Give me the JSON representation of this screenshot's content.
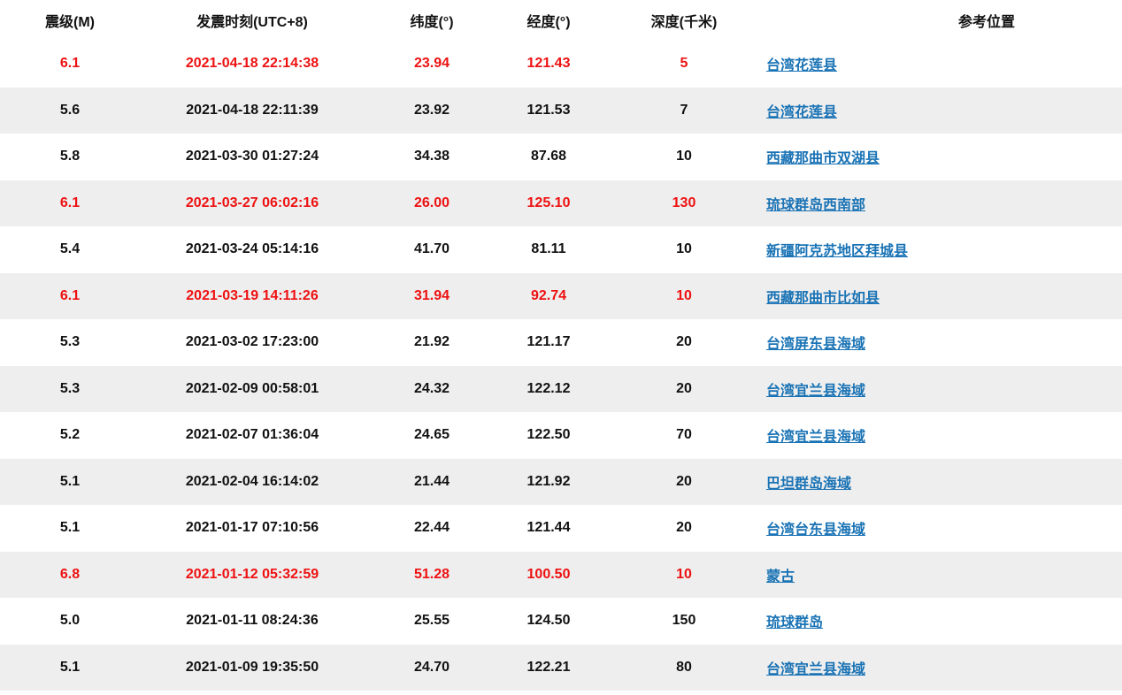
{
  "headers": {
    "magnitude": "震级(M)",
    "time": "发震时刻(UTC+8)",
    "latitude": "纬度(°)",
    "longitude": "经度(°)",
    "depth": "深度(千米)",
    "location": "参考位置"
  },
  "colors": {
    "alert_text": "#ee1111",
    "link": "#1a73b5",
    "row_shade": "#eeeeee"
  },
  "rows": [
    {
      "mag": "6.1",
      "time": "2021-04-18 22:14:38",
      "lat": "23.94",
      "lon": "121.43",
      "depth": "5",
      "loc": "台湾花莲县",
      "alert": true
    },
    {
      "mag": "5.6",
      "time": "2021-04-18 22:11:39",
      "lat": "23.92",
      "lon": "121.53",
      "depth": "7",
      "loc": "台湾花莲县",
      "alert": false
    },
    {
      "mag": "5.8",
      "time": "2021-03-30 01:27:24",
      "lat": "34.38",
      "lon": "87.68",
      "depth": "10",
      "loc": "西藏那曲市双湖县",
      "alert": false
    },
    {
      "mag": "6.1",
      "time": "2021-03-27 06:02:16",
      "lat": "26.00",
      "lon": "125.10",
      "depth": "130",
      "loc": "琉球群岛西南部",
      "alert": true
    },
    {
      "mag": "5.4",
      "time": "2021-03-24 05:14:16",
      "lat": "41.70",
      "lon": "81.11",
      "depth": "10",
      "loc": "新疆阿克苏地区拜城县",
      "alert": false
    },
    {
      "mag": "6.1",
      "time": "2021-03-19 14:11:26",
      "lat": "31.94",
      "lon": "92.74",
      "depth": "10",
      "loc": "西藏那曲市比如县",
      "alert": true
    },
    {
      "mag": "5.3",
      "time": "2021-03-02 17:23:00",
      "lat": "21.92",
      "lon": "121.17",
      "depth": "20",
      "loc": "台湾屏东县海域",
      "alert": false
    },
    {
      "mag": "5.3",
      "time": "2021-02-09 00:58:01",
      "lat": "24.32",
      "lon": "122.12",
      "depth": "20",
      "loc": "台湾宜兰县海域",
      "alert": false
    },
    {
      "mag": "5.2",
      "time": "2021-02-07 01:36:04",
      "lat": "24.65",
      "lon": "122.50",
      "depth": "70",
      "loc": "台湾宜兰县海域",
      "alert": false
    },
    {
      "mag": "5.1",
      "time": "2021-02-04 16:14:02",
      "lat": "21.44",
      "lon": "121.92",
      "depth": "20",
      "loc": "巴坦群岛海域",
      "alert": false
    },
    {
      "mag": "5.1",
      "time": "2021-01-17 07:10:56",
      "lat": "22.44",
      "lon": "121.44",
      "depth": "20",
      "loc": "台湾台东县海域",
      "alert": false
    },
    {
      "mag": "6.8",
      "time": "2021-01-12 05:32:59",
      "lat": "51.28",
      "lon": "100.50",
      "depth": "10",
      "loc": "蒙古",
      "alert": true
    },
    {
      "mag": "5.0",
      "time": "2021-01-11 08:24:36",
      "lat": "25.55",
      "lon": "124.50",
      "depth": "150",
      "loc": "琉球群岛",
      "alert": false
    },
    {
      "mag": "5.1",
      "time": "2021-01-09 19:35:50",
      "lat": "24.70",
      "lon": "122.21",
      "depth": "80",
      "loc": "台湾宜兰县海域",
      "alert": false
    }
  ]
}
